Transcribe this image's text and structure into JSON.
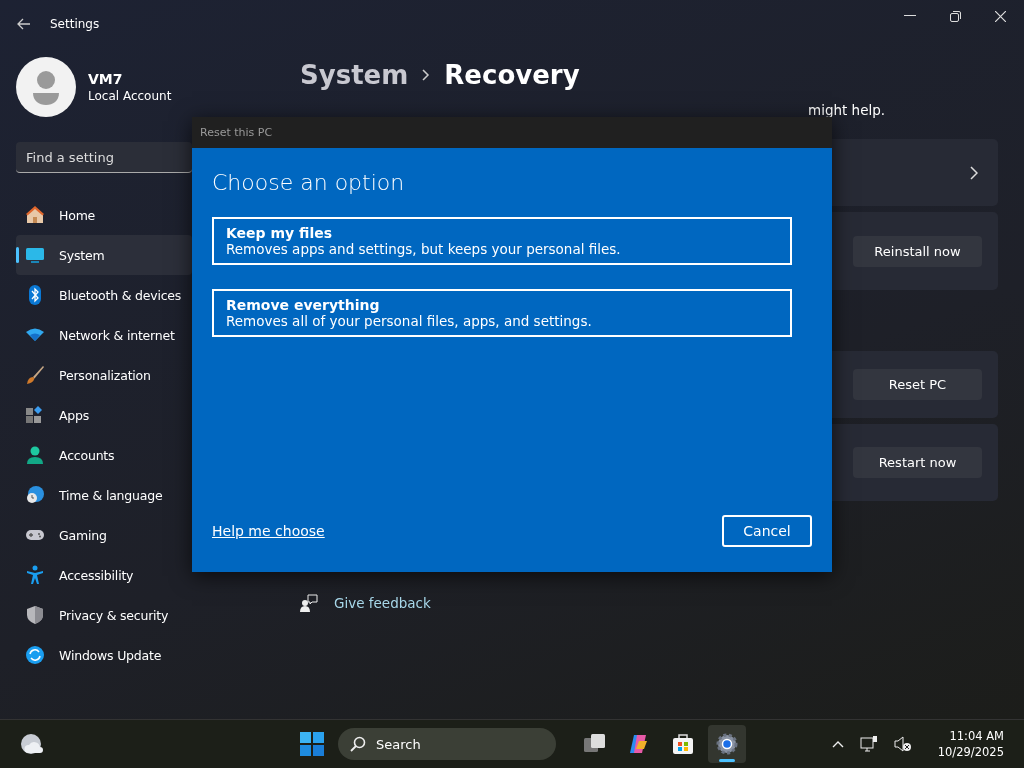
{
  "window": {
    "title": "Settings"
  },
  "account": {
    "name": "VM7",
    "type": "Local Account"
  },
  "search": {
    "placeholder": "Find a setting"
  },
  "sidebar": {
    "items": [
      {
        "label": "Home",
        "kind": "home",
        "selected": false
      },
      {
        "label": "System",
        "kind": "system",
        "selected": true
      },
      {
        "label": "Bluetooth & devices",
        "kind": "bluetooth",
        "selected": false
      },
      {
        "label": "Network & internet",
        "kind": "network",
        "selected": false
      },
      {
        "label": "Personalization",
        "kind": "brush",
        "selected": false
      },
      {
        "label": "Apps",
        "kind": "apps",
        "selected": false
      },
      {
        "label": "Accounts",
        "kind": "accounts",
        "selected": false
      },
      {
        "label": "Time & language",
        "kind": "time",
        "selected": false
      },
      {
        "label": "Gaming",
        "kind": "gaming",
        "selected": false
      },
      {
        "label": "Accessibility",
        "kind": "accessibility",
        "selected": false
      },
      {
        "label": "Privacy & security",
        "kind": "shield",
        "selected": false
      },
      {
        "label": "Windows Update",
        "kind": "update",
        "selected": false
      }
    ]
  },
  "breadcrumb": [
    "System",
    "Recovery"
  ],
  "description": "might help.",
  "cards": [
    {
      "kind": "chevron"
    },
    {
      "kind": "button",
      "button": "Reinstall now"
    },
    {
      "kind": "button",
      "button": "Reset PC"
    },
    {
      "kind": "button",
      "button": "Restart now"
    }
  ],
  "links": [
    {
      "label": "Give feedback"
    }
  ],
  "dialog": {
    "title": "Reset this PC",
    "heading": "Choose an option",
    "options": [
      {
        "title": "Keep my files",
        "description": "Removes apps and settings, but keeps your personal files."
      },
      {
        "title": "Remove everything",
        "description": "Removes all of your personal files, apps, and settings."
      }
    ],
    "help_link": "Help me choose",
    "cancel": "Cancel"
  },
  "taskbar": {
    "search_placeholder": "Search",
    "apps": [
      {
        "kind": "taskview",
        "selected": false
      },
      {
        "kind": "copilot",
        "selected": false
      },
      {
        "kind": "store",
        "selected": false
      },
      {
        "kind": "settings",
        "selected": true
      }
    ],
    "clock": {
      "time": "11:04 AM",
      "date": "10/29/2025"
    }
  }
}
